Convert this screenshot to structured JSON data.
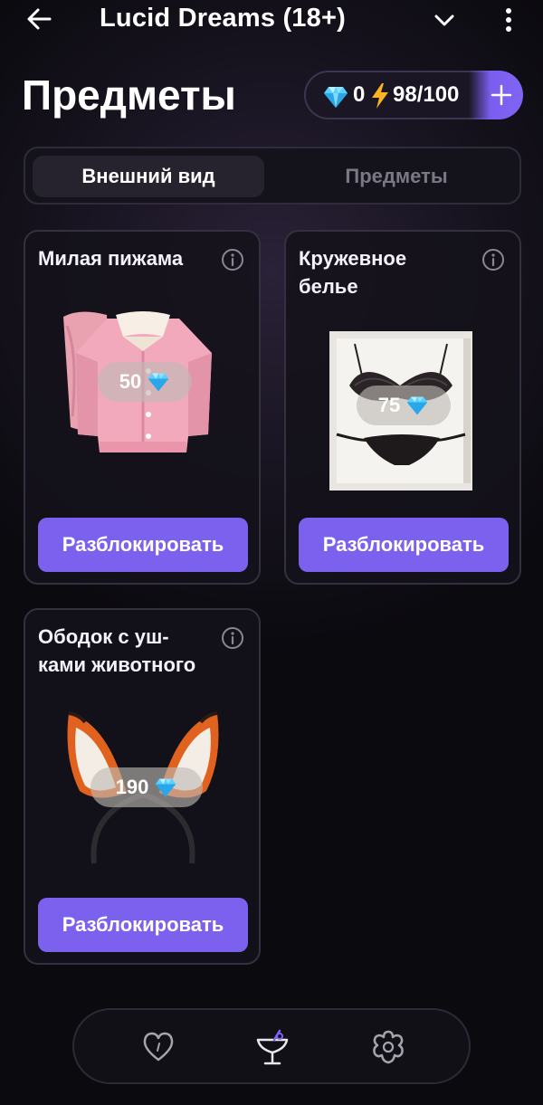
{
  "header": {
    "app_title": "Lucid Dreams (18+)",
    "back_icon": "arrow-left-icon",
    "dropdown_icon": "chevron-down-icon",
    "more_icon": "more-vertical-icon"
  },
  "page": {
    "title": "Предметы"
  },
  "currency": {
    "gem_icon": "diamond-icon",
    "gems": "0",
    "energy_icon": "lightning-icon",
    "energy": "98/100",
    "add_icon": "plus-icon"
  },
  "tabs": [
    {
      "label": "Внешний вид",
      "active": true
    },
    {
      "label": "Предметы",
      "active": false
    }
  ],
  "items": [
    {
      "title": "Милая пижама",
      "price": "50",
      "button": "Разблокировать",
      "image": "pink-pajama-image"
    },
    {
      "title": "Кружевное белье",
      "price": "75",
      "button": "Разблокировать",
      "image": "lace-lingerie-image"
    },
    {
      "title": "Ободок с уш-ками животного",
      "price": "190",
      "button": "Разблокировать",
      "image": "fox-ears-headband-image"
    }
  ],
  "bottom_nav": [
    {
      "icon": "heart-icon",
      "active": false
    },
    {
      "icon": "cocktail-glass-icon",
      "active": true
    },
    {
      "icon": "flower-gear-icon",
      "active": false
    }
  ],
  "colors": {
    "accent": "#7c61ee",
    "background": "#0b0a0f",
    "card_border": "#34303f"
  }
}
